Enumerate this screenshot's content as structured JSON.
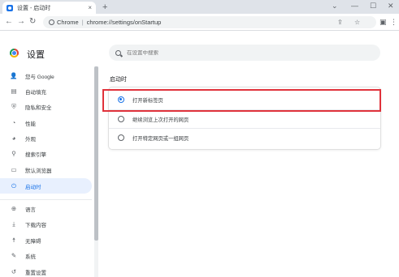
{
  "browser": {
    "tab_title": "设置 - 启动时",
    "tab_close": "×",
    "new_tab": "+",
    "window_controls": [
      "⌄",
      "—",
      "☐",
      "✕"
    ],
    "back": "←",
    "forward": "→",
    "reload": "↻",
    "scheme": "Chrome",
    "url_sep": "|",
    "url": "chrome://settings/onStartup"
  },
  "settings": {
    "title": "设置",
    "search_placeholder": "在设置中搜索"
  },
  "sidebar": {
    "items": [
      {
        "icon": "person-icon",
        "glyph": "👤",
        "label": "您与 Google"
      },
      {
        "icon": "autofill-icon",
        "glyph": "▤",
        "label": "自动填充"
      },
      {
        "icon": "shield-icon",
        "glyph": "⛨",
        "label": "隐私和安全"
      },
      {
        "icon": "speedometer-icon",
        "glyph": "◔",
        "label": "性能"
      },
      {
        "icon": "palette-icon",
        "glyph": "◕",
        "label": "外观"
      },
      {
        "icon": "search-icon",
        "glyph": "⚲",
        "label": "搜索引擎"
      },
      {
        "icon": "browser-icon",
        "glyph": "▭",
        "label": "默认浏览器"
      },
      {
        "icon": "power-icon",
        "glyph": "⏻",
        "label": "启动时"
      },
      {
        "icon": "globe-icon",
        "glyph": "⊕",
        "label": "语言"
      },
      {
        "icon": "download-icon",
        "glyph": "⤓",
        "label": "下载内容"
      },
      {
        "icon": "accessibility-icon",
        "glyph": "☨",
        "label": "无障碍"
      },
      {
        "icon": "wrench-icon",
        "glyph": "✎",
        "label": "系统"
      },
      {
        "icon": "reset-icon",
        "glyph": "↺",
        "label": "重置设置"
      }
    ],
    "active_index": 7
  },
  "startup": {
    "section_title": "启动时",
    "options": [
      {
        "label": "打开新标签页",
        "checked": true
      },
      {
        "label": "继续浏览上次打开的网页",
        "checked": false
      },
      {
        "label": "打开特定网页或一组网页",
        "checked": false
      }
    ]
  },
  "colors": {
    "accent": "#1a73e8",
    "highlight": "#e0323b",
    "active_bg": "#e8f0fe"
  }
}
